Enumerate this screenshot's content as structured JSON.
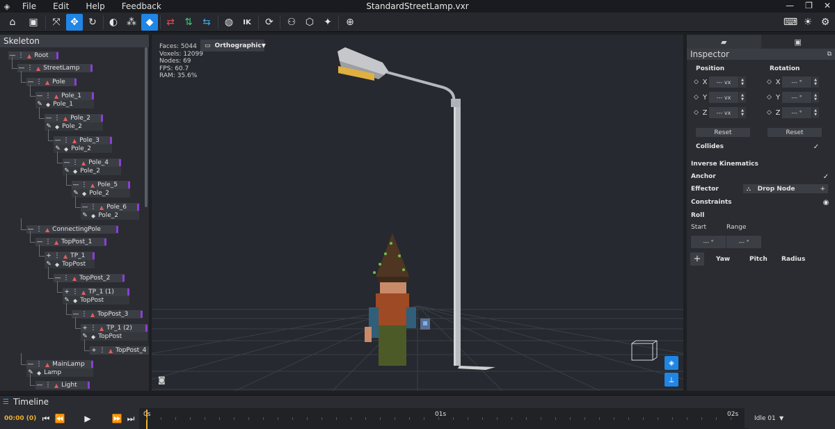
{
  "window": {
    "title": "StandardStreetLamp.vxr",
    "menus": [
      "File",
      "Edit",
      "Help",
      "Feedback"
    ]
  },
  "toolbar": {
    "ik_label": "IK"
  },
  "skeleton": {
    "title": "Skeleton",
    "nodes": [
      {
        "name": "Root"
      },
      {
        "name": "StreetLamp"
      },
      {
        "name": "Pole"
      },
      {
        "name": "Pole_1",
        "mesh": "Pole_1"
      },
      {
        "name": "Pole_2",
        "mesh": "Pole_2"
      },
      {
        "name": "Pole_3",
        "mesh": "Pole_2"
      },
      {
        "name": "Pole_4",
        "mesh": "Pole_2"
      },
      {
        "name": "Pole_5",
        "mesh": "Pole_2"
      },
      {
        "name": "Pole_6",
        "mesh": "Pole_2"
      },
      {
        "name": "ConnectingPole"
      },
      {
        "name": "TopPost_1"
      },
      {
        "name": "TP_1",
        "mesh": "TopPost"
      },
      {
        "name": "TopPost_2"
      },
      {
        "name": "TP_1 (1)",
        "mesh": "TopPost"
      },
      {
        "name": "TopPost_3"
      },
      {
        "name": "TP_1 (2)",
        "mesh": "TopPost"
      },
      {
        "name": "TopPost_4"
      },
      {
        "name": "MainLamp",
        "mesh": "Lamp"
      },
      {
        "name": "Light"
      }
    ]
  },
  "viewport": {
    "stats": {
      "faces": "Faces: 5044",
      "voxels": "Voxels: 12099",
      "nodes": "Nodes: 69",
      "fps": "FPS: 60.7",
      "ram": "RAM: 35.6%"
    },
    "projection": "Orthographic"
  },
  "inspector": {
    "title": "Inspector",
    "position_label": "Position",
    "rotation_label": "Rotation",
    "axes": [
      "X",
      "Y",
      "Z"
    ],
    "position_placeholder": "--- vx",
    "rotation_placeholder": "--- °",
    "reset_label": "Reset",
    "collides_label": "Collides",
    "ik_title": "Inverse Kinematics",
    "anchor_label": "Anchor",
    "effector_label": "Effector",
    "effector_value": "Drop Node",
    "constraints_label": "Constraints",
    "roll_label": "Roll",
    "start_label": "Start",
    "range_label": "Range",
    "roll_start_value": "--- °",
    "roll_range_value": "--- °",
    "yaw_label": "Yaw",
    "pitch_label": "Pitch",
    "radius_label": "Radius"
  },
  "timeline": {
    "title": "Timeline",
    "time": "00:00 (0)",
    "labels": [
      "0s",
      "01s",
      "02s"
    ],
    "animation": "Idle 01"
  },
  "colors": {
    "accent": "#1f86e6",
    "playhead": "#f0b030",
    "bone_icon": "#e06060",
    "node_tag": "#8b3fd8"
  }
}
